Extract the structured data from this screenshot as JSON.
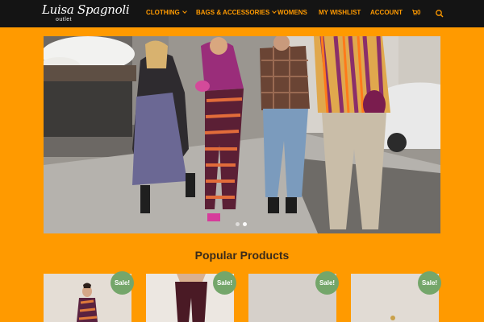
{
  "header": {
    "logo": {
      "script": "Luisa Spagnoli",
      "sub": "outlet"
    },
    "nav": [
      {
        "label": "CLOTHING",
        "dropdown": true
      },
      {
        "label": "BAGS & ACCESSORIES",
        "dropdown": true
      },
      {
        "label": "WOMENS",
        "dropdown": false
      },
      {
        "label": "MY WISHLIST",
        "dropdown": false
      },
      {
        "label": "ACCOUNT",
        "dropdown": false
      }
    ],
    "cart_count": "0",
    "icons": {
      "cart": "cart-icon",
      "search": "search-icon",
      "dropdown": "chevron-down-icon"
    }
  },
  "hero": {
    "slider_dots": 2,
    "active_dot": 1
  },
  "popular": {
    "title": "Popular Products",
    "products": [
      {
        "badge": "Sale!"
      },
      {
        "badge": "Sale!"
      },
      {
        "badge": "Sale!"
      },
      {
        "badge": "Sale!"
      }
    ]
  },
  "colors": {
    "page_background": "#ff9a00",
    "nav_background": "#141414",
    "nav_text": "#ff9a00",
    "sale_badge": "#74a66a",
    "title_text": "#3a2a1a"
  }
}
